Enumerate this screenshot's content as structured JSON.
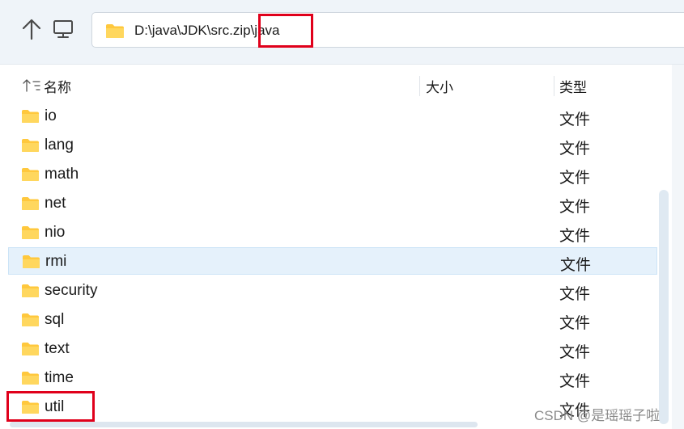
{
  "toolbar": {
    "up_icon": "arrow-up-icon",
    "pc_icon": "computer-icon",
    "address": {
      "icon": "folder-icon",
      "path": "D:\\java\\JDK\\src.zip\\java"
    }
  },
  "columns": {
    "name": "名称",
    "size": "大小",
    "type": "类型",
    "sort_icon": "sort-icon"
  },
  "files": [
    {
      "name": "io",
      "type": "文件"
    },
    {
      "name": "lang",
      "type": "文件"
    },
    {
      "name": "math",
      "type": "文件"
    },
    {
      "name": "net",
      "type": "文件"
    },
    {
      "name": "nio",
      "type": "文件"
    },
    {
      "name": "rmi",
      "type": "文件"
    },
    {
      "name": "security",
      "type": "文件"
    },
    {
      "name": "sql",
      "type": "文件"
    },
    {
      "name": "text",
      "type": "文件"
    },
    {
      "name": "time",
      "type": "文件"
    },
    {
      "name": "util",
      "type": "文件"
    }
  ],
  "selected_item": "rmi",
  "colors": {
    "folder": "#ffc83d",
    "highlight": "#e0001b",
    "selection": "#e5f1fb"
  },
  "watermark": "CSDN @是瑶瑶子啦"
}
